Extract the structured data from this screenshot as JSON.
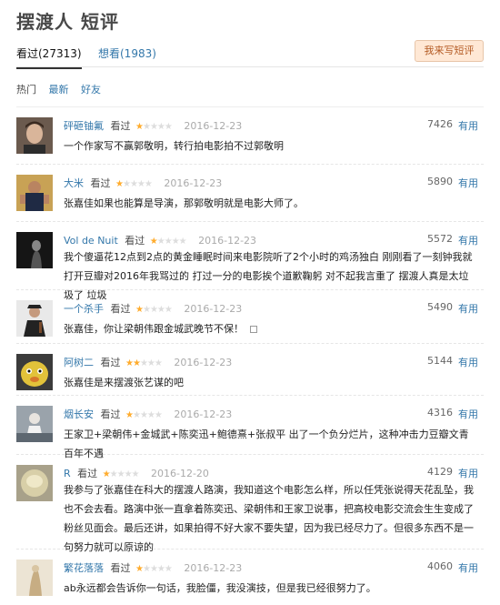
{
  "page": {
    "title": "摆渡人 短评"
  },
  "tabs": {
    "watched": "看过(27313)",
    "want": "想看(1983)"
  },
  "write_button": "我来写短评",
  "sort": [
    "热门",
    "最新",
    "好友"
  ],
  "colors": {
    "link": "#3377aa",
    "star": "#ffac2d",
    "button_bg": "#ffe8d5",
    "button_text": "#b35a23"
  },
  "comments": [
    {
      "user": "砰砸铀氟",
      "status": "看过",
      "rating": 1,
      "date": "2016-12-23",
      "votes": "7426",
      "useful": "有用",
      "text": "一个作家写不赢郭敬明，转行拍电影拍不过郭敬明"
    },
    {
      "user": "大米",
      "status": "看过",
      "rating": 1,
      "date": "2016-12-23",
      "votes": "5890",
      "useful": "有用",
      "text": "张嘉佳如果也能算是导演，那郭敬明就是电影大师了。"
    },
    {
      "user": "Vol de Nuit",
      "status": "看过",
      "rating": 1,
      "date": "2016-12-23",
      "votes": "5572",
      "useful": "有用",
      "text": "我个傻逼花12点到2点的黄金睡眠时间来电影院听了2个小时的鸡汤独白 刚刚看了一刻钟我就打开豆瓣对2016年我骂过的 打过一分的电影挨个道歉鞠躬 对不起我言重了 摆渡人真是太垃圾了 垃圾"
    },
    {
      "user": "一个杀手",
      "status": "看过",
      "rating": 1,
      "date": "2016-12-23",
      "votes": "5490",
      "useful": "有用",
      "text": "张嘉佳，你让梁朝伟跟金城武晚节不保！",
      "has_image": true
    },
    {
      "user": "阿树二",
      "status": "看过",
      "rating": 2,
      "date": "2016-12-23",
      "votes": "5144",
      "useful": "有用",
      "text": "张嘉佳是来摆渡张艺谋的吧"
    },
    {
      "user": "烟长安",
      "status": "看过",
      "rating": 1,
      "date": "2016-12-23",
      "votes": "4316",
      "useful": "有用",
      "text": "王家卫+梁朝伟+金城武+陈奕迅+鲍德熹+张叔平 出了一个负分烂片，这种冲击力豆瓣文青百年不遇"
    },
    {
      "user": "R",
      "status": "看过",
      "rating": 1,
      "date": "2016-12-20",
      "votes": "4129",
      "useful": "有用",
      "text": "我参与了张嘉佳在科大的摆渡人路演，我知道这个电影怎么样，所以任凭张说得天花乱坠，我也不会去看。路演中张一直拿着陈奕迅、梁朝伟和王家卫说事，把高校电影交流会生生变成了粉丝见面会。最后还讲，如果拍得不好大家不要失望，因为我已经尽力了。但很多东西不是一句努力就可以原谅的"
    },
    {
      "user": "繁花落落",
      "status": "看过",
      "rating": 1,
      "date": "2016-12-23",
      "votes": "4060",
      "useful": "有用",
      "text": "ab永远都会告诉你一句话，我脸僵，我没演技，但是我已经很努力了。"
    }
  ]
}
